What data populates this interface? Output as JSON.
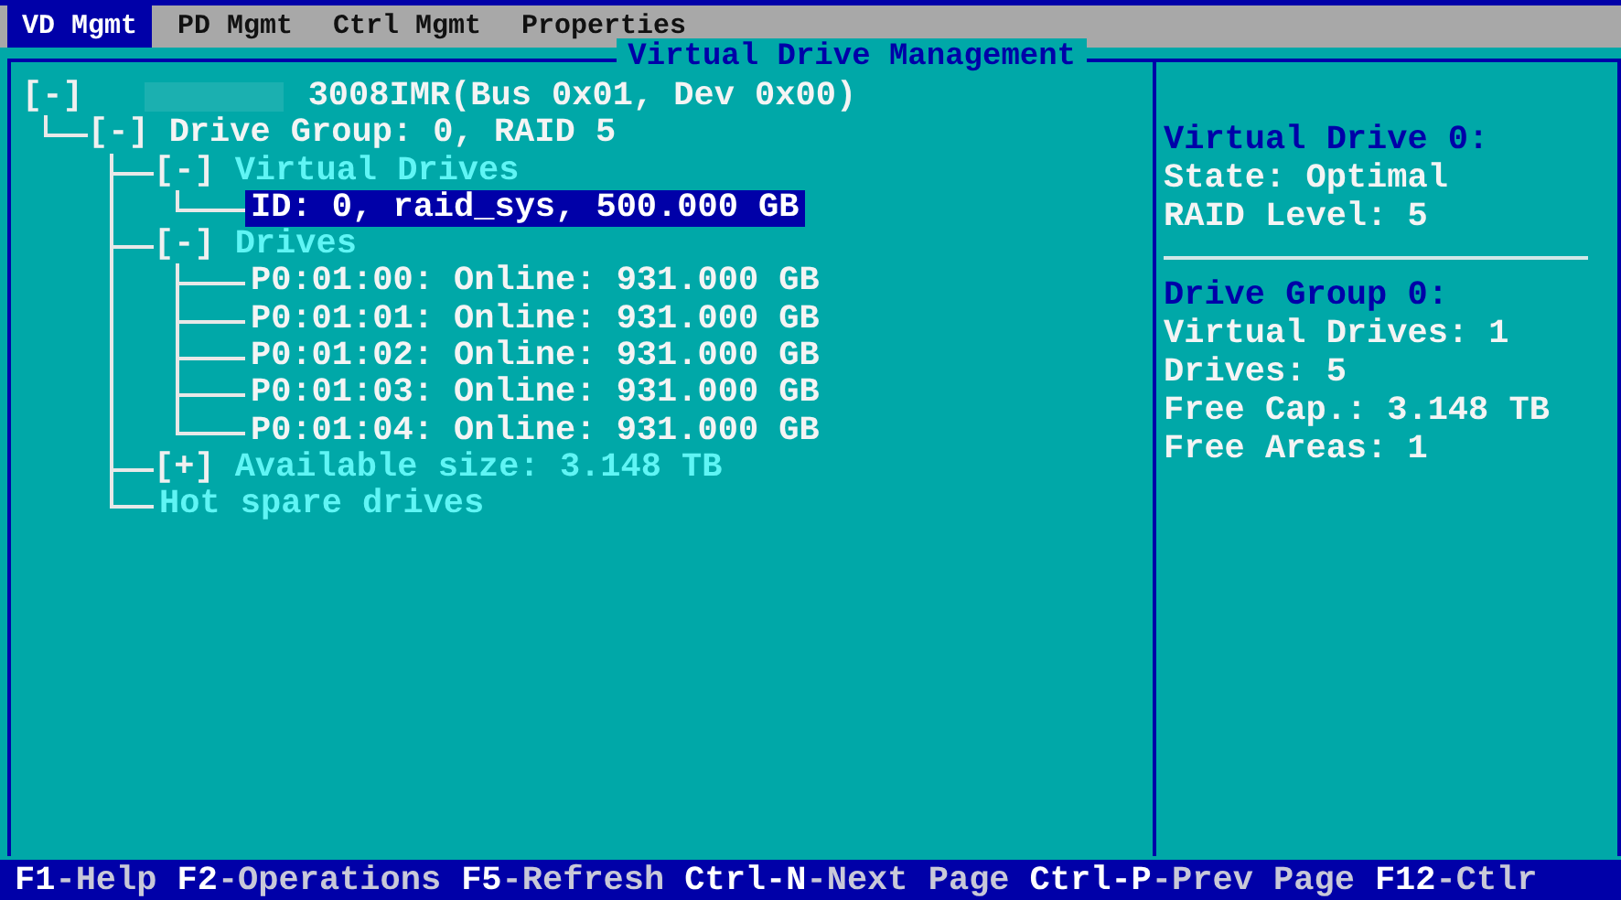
{
  "tabs": [
    {
      "label": "VD Mgmt",
      "selected": true
    },
    {
      "label": "PD Mgmt",
      "selected": false
    },
    {
      "label": "Ctrl Mgmt",
      "selected": false
    },
    {
      "label": "Properties",
      "selected": false
    }
  ],
  "tree_panel": {
    "title": "Virtual Drive Management",
    "tree": [
      {
        "kind": "controller",
        "toggle": "[-]",
        "label": "3008IMR(Bus 0x01, Dev 0x00)",
        "selected": false,
        "children": [
          {
            "kind": "group",
            "toggle": "[-]",
            "label": "Drive Group: 0, RAID 5",
            "selected": false,
            "children": [
              {
                "kind": "category",
                "toggle": "[-]",
                "label": "Virtual Drives",
                "selected": false,
                "children": [
                  {
                    "kind": "item",
                    "label": "ID: 0, raid_sys, 500.000 GB",
                    "selected": true
                  }
                ]
              },
              {
                "kind": "category",
                "toggle": "[-]",
                "label": "Drives",
                "selected": false,
                "children": [
                  {
                    "kind": "item",
                    "label": "P0:01:00: Online: 931.000 GB",
                    "selected": false
                  },
                  {
                    "kind": "item",
                    "label": "P0:01:01: Online: 931.000 GB",
                    "selected": false
                  },
                  {
                    "kind": "item",
                    "label": "P0:01:02: Online: 931.000 GB",
                    "selected": false
                  },
                  {
                    "kind": "item",
                    "label": "P0:01:03: Online: 931.000 GB",
                    "selected": false
                  },
                  {
                    "kind": "item",
                    "label": "P0:01:04: Online: 931.000 GB",
                    "selected": false
                  }
                ]
              },
              {
                "kind": "category",
                "toggle": "[+]",
                "label": "Available size: 3.148 TB",
                "selected": false
              },
              {
                "kind": "category",
                "label": "Hot spare drives",
                "selected": false
              }
            ]
          }
        ]
      }
    ]
  },
  "info_panel": {
    "sections": [
      {
        "heading": "Virtual Drive 0:",
        "lines": [
          "State: Optimal",
          "RAID Level: 5"
        ]
      },
      {
        "heading": "Drive Group 0:",
        "lines": [
          "Virtual Drives: 1",
          "Drives: 5",
          "Free Cap.: 3.148 TB",
          "Free Areas: 1"
        ]
      }
    ]
  },
  "status_bar": [
    {
      "key": "F1",
      "action": "-Help"
    },
    {
      "key": "F2",
      "action": "-Operations"
    },
    {
      "key": "F5",
      "action": "-Refresh"
    },
    {
      "key": "Ctrl-N",
      "action": "-Next Page"
    },
    {
      "key": "Ctrl-P",
      "action": "-Prev Page"
    },
    {
      "key": "F12",
      "action": "-Ctlr"
    }
  ]
}
